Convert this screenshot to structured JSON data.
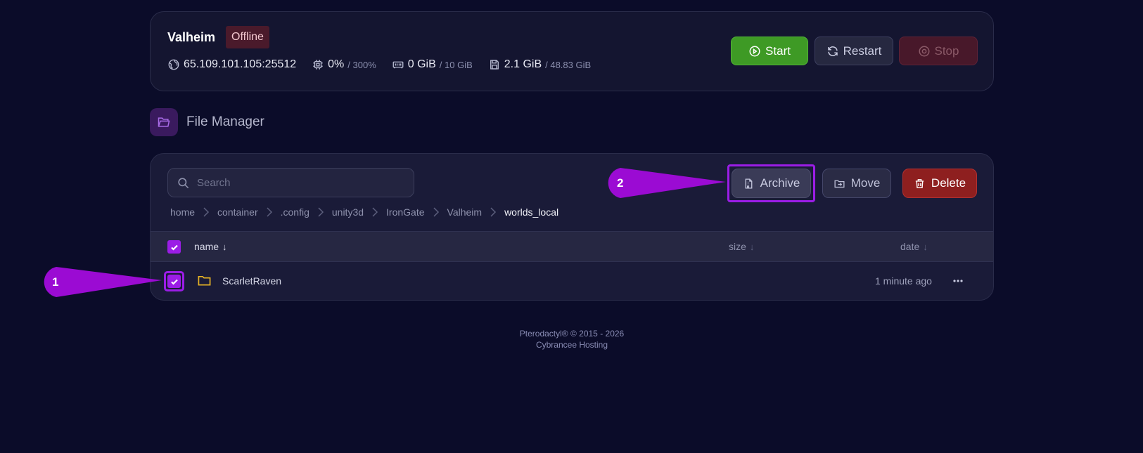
{
  "server": {
    "name": "Valheim",
    "status": "Offline",
    "address": "65.109.101.105:25512",
    "cpu": "0%",
    "cpu_limit": "/ 300%",
    "memory": "0 GiB",
    "memory_limit": "/ 10 GiB",
    "disk": "2.1 GiB",
    "disk_limit": "/ 48.83 GiB",
    "icons": [
      "globe-icon",
      "cpu-icon",
      "memory-icon",
      "disk-icon"
    ]
  },
  "power": {
    "start_label": "Start",
    "restart_label": "Restart",
    "stop_label": "Stop"
  },
  "section": {
    "title": "File Manager",
    "icon": "folder-open-icon"
  },
  "file_manager": {
    "search_placeholder": "Search",
    "archive_label": "Archive",
    "move_label": "Move",
    "delete_label": "Delete",
    "breadcrumb": [
      "home",
      "container",
      ".config",
      "unity3d",
      "IronGate",
      "Valheim",
      "worlds_local"
    ],
    "columns": {
      "name": "name",
      "size": "size",
      "date": "date",
      "sort_arrow": "↓"
    },
    "files": [
      {
        "name": "ScarletRaven",
        "type": "folder",
        "date": "1 minute ago",
        "selected": true
      }
    ]
  },
  "annotations": [
    "1",
    "2"
  ],
  "footer": {
    "line1": "Pterodactyl® © 2015 - 2026",
    "line2": "Cybrancee Hosting"
  },
  "colors": {
    "background": "#0b0c29",
    "accent": "#9b1de6",
    "start": "#3e9a25",
    "delete": "#8e1f1f",
    "folder": "#e6b325"
  }
}
